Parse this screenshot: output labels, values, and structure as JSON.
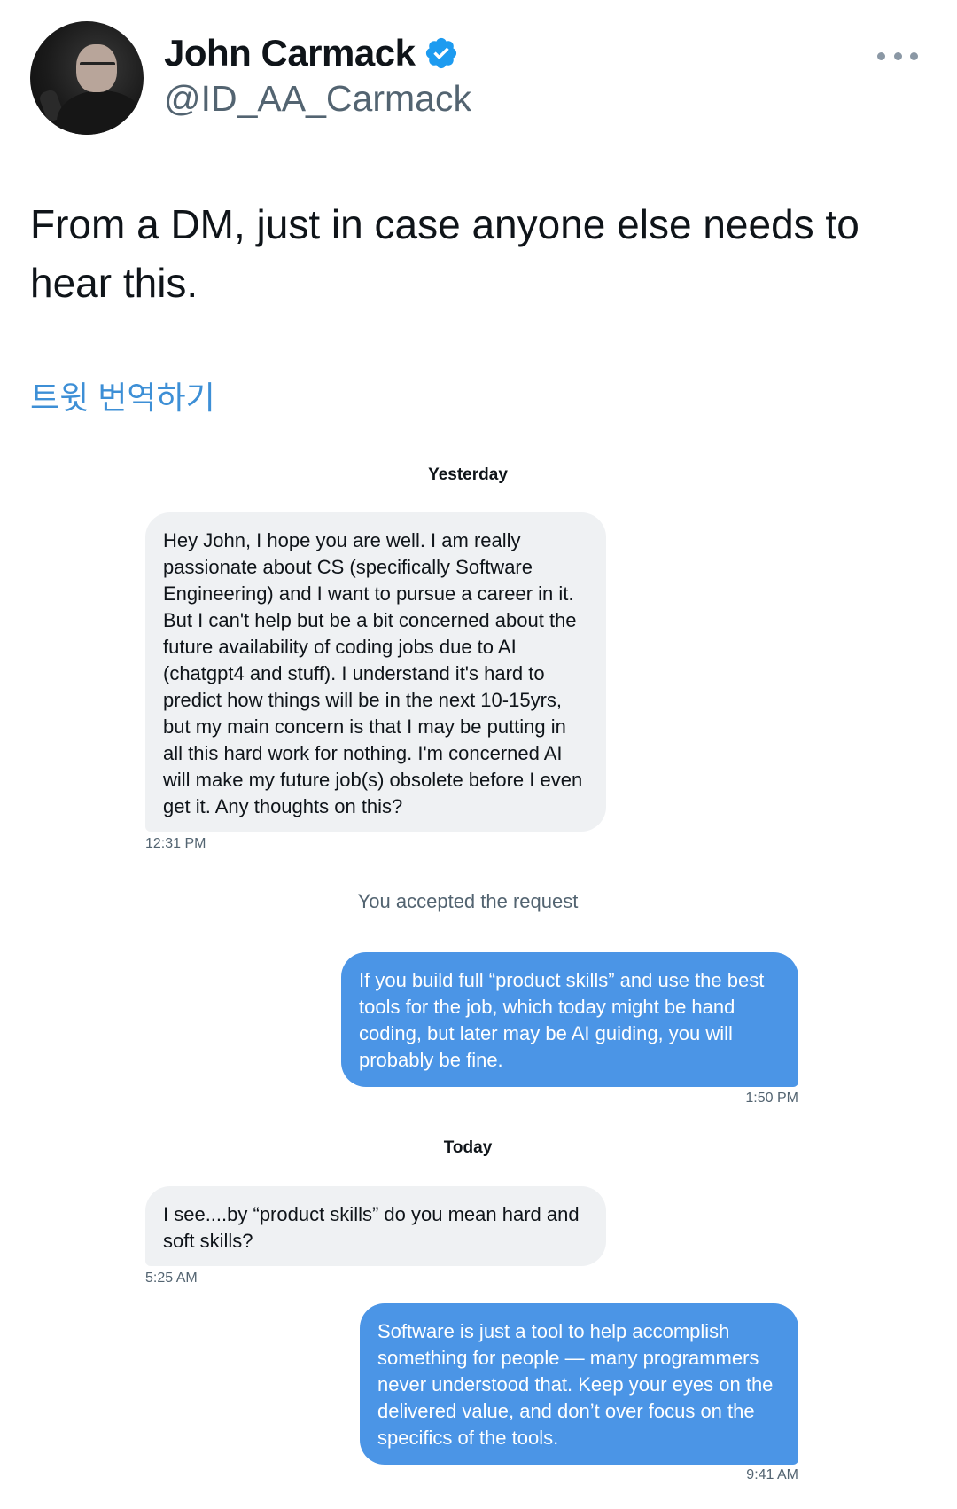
{
  "author": {
    "name": "John Carmack",
    "handle": "@ID_AA_Carmack",
    "verified": true,
    "verified_color": "#1d9bf0"
  },
  "tweet": {
    "text": "From a DM, just in case anyone else needs to hear this.",
    "translate_label": "트윗 번역하기"
  },
  "icons": {
    "more": "more-horizontal-icon",
    "verified": "verified-badge-icon"
  },
  "dm": {
    "sections": [
      {
        "label": "Yesterday"
      },
      {
        "label": "Today"
      }
    ],
    "system_note": "You accepted the request",
    "messages": [
      {
        "direction": "incoming",
        "text": "Hey John, I hope you are well. I am really passionate about CS (specifically Software Engineering) and I want to pursue a career in it. But I can't help but be a bit concerned about the future availability of coding jobs due to AI (chatgpt4 and stuff). I understand it's hard to predict how things will be in the next 10-15yrs, but my main concern is that I may be putting in all this hard work for nothing. I'm concerned AI will make my future job(s) obsolete before I even get it. Any thoughts on this?",
        "time": "12:31 PM"
      },
      {
        "direction": "outgoing",
        "text": "If you build full “product skills” and use the best tools for the job, which today might be hand coding, but later may be AI guiding, you will probably be fine.",
        "time": "1:50 PM"
      },
      {
        "direction": "incoming",
        "text": "I see....by “product skills” do you mean hard and soft skills?",
        "time": "5:25 AM"
      },
      {
        "direction": "outgoing",
        "text": "Software is just a tool to help accomplish something for people — many programmers never understood that. Keep your eyes on the delivered value, and don’t over focus on the specifics of the tools.",
        "time": "9:41 AM"
      }
    ]
  },
  "colors": {
    "incoming_bubble": "#eff1f3",
    "outgoing_bubble": "#4b95e6",
    "link": "#3d8fd6",
    "muted_text": "#536471"
  }
}
